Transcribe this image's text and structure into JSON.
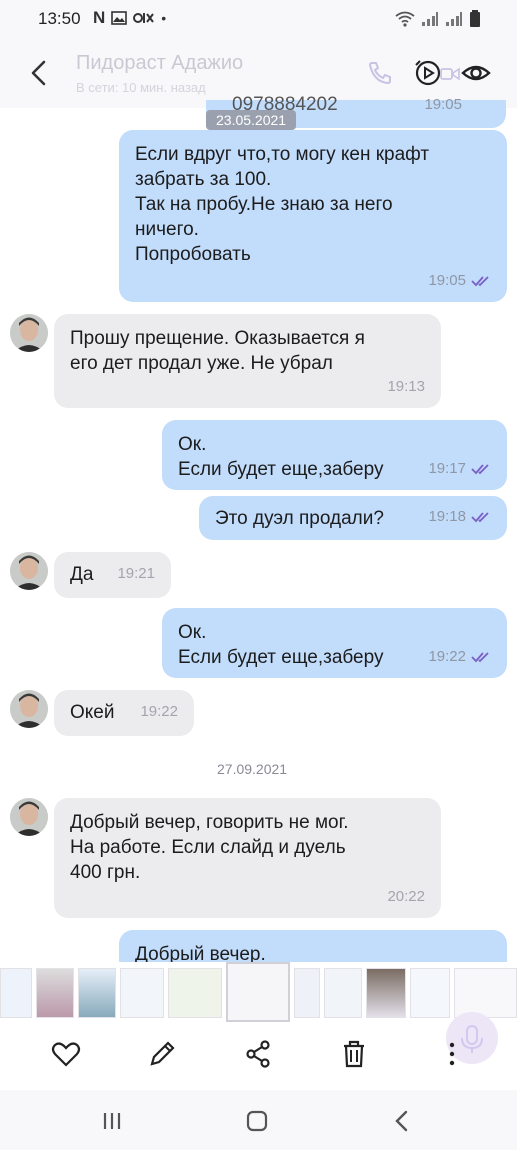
{
  "status_bar": {
    "time": "13:50",
    "left_icons": [
      "n-icon",
      "image-icon",
      "olx-icon",
      "dot-icon"
    ],
    "right_icons": [
      "wifi-icon",
      "signal-icon",
      "signal-icon",
      "battery-icon"
    ]
  },
  "header": {
    "contact_name": "Пидораст Адажио",
    "status": "В сети: 10 мин. назад"
  },
  "floating_date": "23.05.2021",
  "partial_message_text": "0978884202",
  "partial_message_time": "19:05",
  "messages": [
    {
      "direction": "out",
      "text": "Если вдруг что,то могу кен крафт\nзабрать за 100.\nТак на пробу.Не знаю за него\nничего.\nПопробовать",
      "time": "19:05"
    },
    {
      "direction": "in",
      "text": "Прошу прещение. Оказывается я\nего дет продал уже. Не убрал",
      "time": "19:13"
    },
    {
      "direction": "out",
      "text": "Ок.\nЕсли будет еще,заберу",
      "time": "19:17"
    },
    {
      "direction": "out",
      "text": "Это дуэл продали?",
      "time": "19:18"
    },
    {
      "direction": "in",
      "text": "Да",
      "time": "19:21"
    },
    {
      "direction": "out",
      "text": "Ок.\nЕсли будет еще,заберу",
      "time": "19:22"
    },
    {
      "direction": "in",
      "text": "Окей",
      "time": "19:22"
    },
    {
      "direction": "in",
      "text": "Добрый вечер, говорить не мог.\nНа работе. Если слайд и дуель\n400 грн.",
      "time": "20:22"
    },
    {
      "direction": "out",
      "text": "Добрый вечер.",
      "time": ""
    }
  ],
  "date_separator": "27.09.2021",
  "toolbar": {
    "icons": [
      "heart-icon",
      "edit-icon",
      "share-icon",
      "delete-icon",
      "more-icon"
    ]
  },
  "nav": {
    "icons": [
      "recent-apps-icon",
      "home-icon",
      "back-icon"
    ]
  },
  "colors": {
    "outgoing_bubble": "#c2dcfb",
    "incoming_bubble": "#ececef",
    "accent": "#7a5fc7"
  }
}
